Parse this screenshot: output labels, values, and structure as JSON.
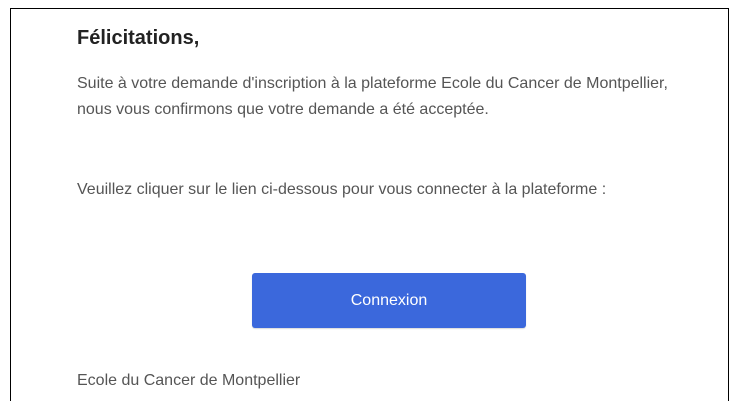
{
  "email": {
    "greeting": "Félicitations,",
    "paragraph1": "Suite à votre demande d'inscription à la plateforme Ecole du Cancer de Montpellier, nous vous confirmons que votre demande a été acceptée.",
    "paragraph2": "Veuillez cliquer sur le lien ci-dessous pour vous connecter à la plateforme :",
    "button_label": "Connexion",
    "signature": "Ecole du Cancer de Montpellier"
  },
  "colors": {
    "button_bg": "#3b68dc",
    "button_text": "#ffffff",
    "body_text": "#555555",
    "heading_text": "#222222"
  }
}
